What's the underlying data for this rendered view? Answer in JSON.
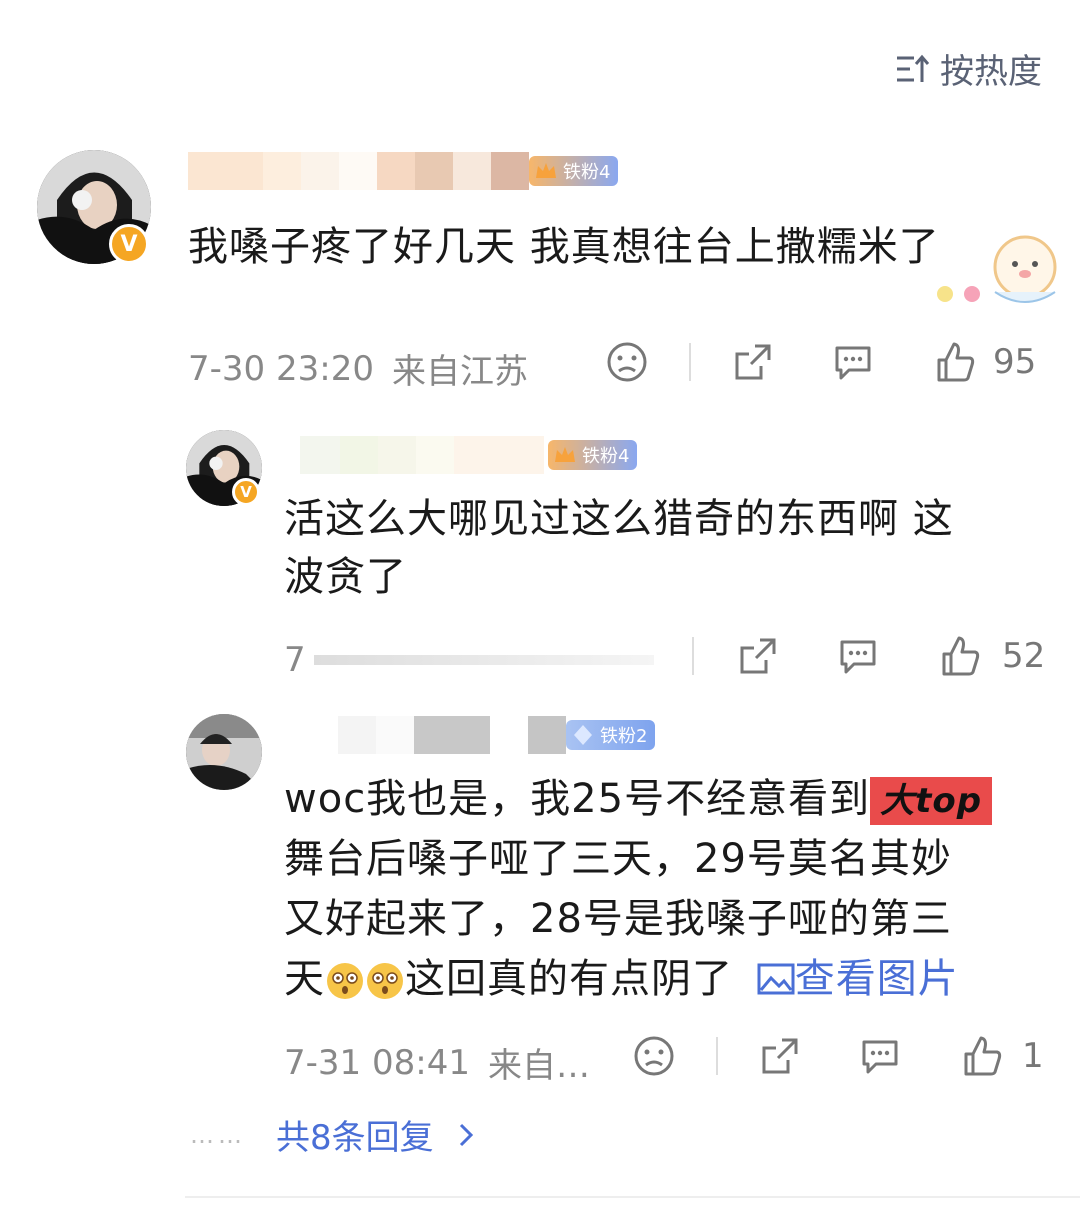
{
  "sort": {
    "label": "按热度",
    "icon": "sort-icon"
  },
  "comments": [
    {
      "fan_badge": "铁粉4",
      "text": "我嗓子疼了好几天 我真想往台上撒糯米了",
      "time": "7-30 23:20",
      "location": "来自江苏",
      "likes": "95"
    },
    {
      "fan_badge": "铁粉4",
      "text_line1": "活这么大哪见过这么猎奇的东西啊 这",
      "text_line2": "波贪了",
      "time_partial": "7",
      "likes": "52"
    },
    {
      "fan_badge": "铁粉2",
      "line1_pre": "woc我也是，我25号不经意看到",
      "tag": "大top",
      "line2": "舞台后嗓子哑了三天，29号莫名其妙",
      "line3": "又好起来了，28号是我嗓子哑的第三",
      "line4_pre": "天",
      "line4_post": "这回真的有点阴了",
      "view_image": "查看图片",
      "time": "7-31 08:41",
      "location": "来自…",
      "likes": "1"
    }
  ],
  "replies": {
    "dots": "……",
    "label": "共8条回复"
  },
  "colors": {
    "accent": "#4a6fd6",
    "badge_orange": "#f5a623",
    "tag_red": "#e94b4b"
  }
}
